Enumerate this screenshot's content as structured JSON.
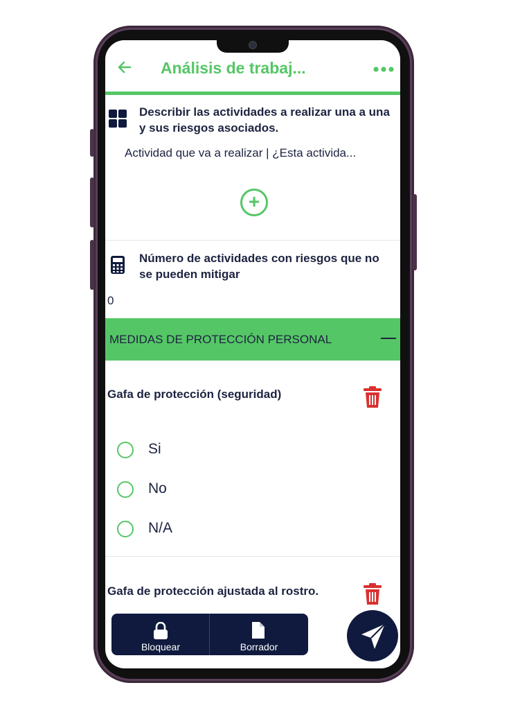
{
  "colors": {
    "accent": "#55c666",
    "navy": "#0f1a3e",
    "danger": "#d93030"
  },
  "appbar": {
    "back_icon": "arrow-left-icon",
    "title": "Análisis de trabaj...",
    "more_icon": "more-dots-icon"
  },
  "question1": {
    "icon": "grid-icon",
    "text": "Describir las actividades a realizar una a una y sus riesgos asociados.",
    "subtitle": "Actividad que va a realizar | ¿Esta activida...",
    "add_icon": "plus-circle-icon"
  },
  "question2": {
    "icon": "calculator-icon",
    "text": "Número de actividades con riesgos que no se pueden mitigar",
    "value": "0"
  },
  "section": {
    "label": "MEDIDAS DE PROTECCIÓN PERSONAL",
    "collapse_icon": "minus-icon"
  },
  "item1": {
    "title": "Gafa de protección (seguridad)",
    "options": [
      "Si",
      "No",
      "N/A"
    ]
  },
  "item2": {
    "title": "Gafa de protección ajustada al rostro."
  },
  "toolbar": {
    "lock_label": "Bloquear",
    "draft_label": "Borrador"
  },
  "fab": {
    "icon": "send-icon"
  }
}
